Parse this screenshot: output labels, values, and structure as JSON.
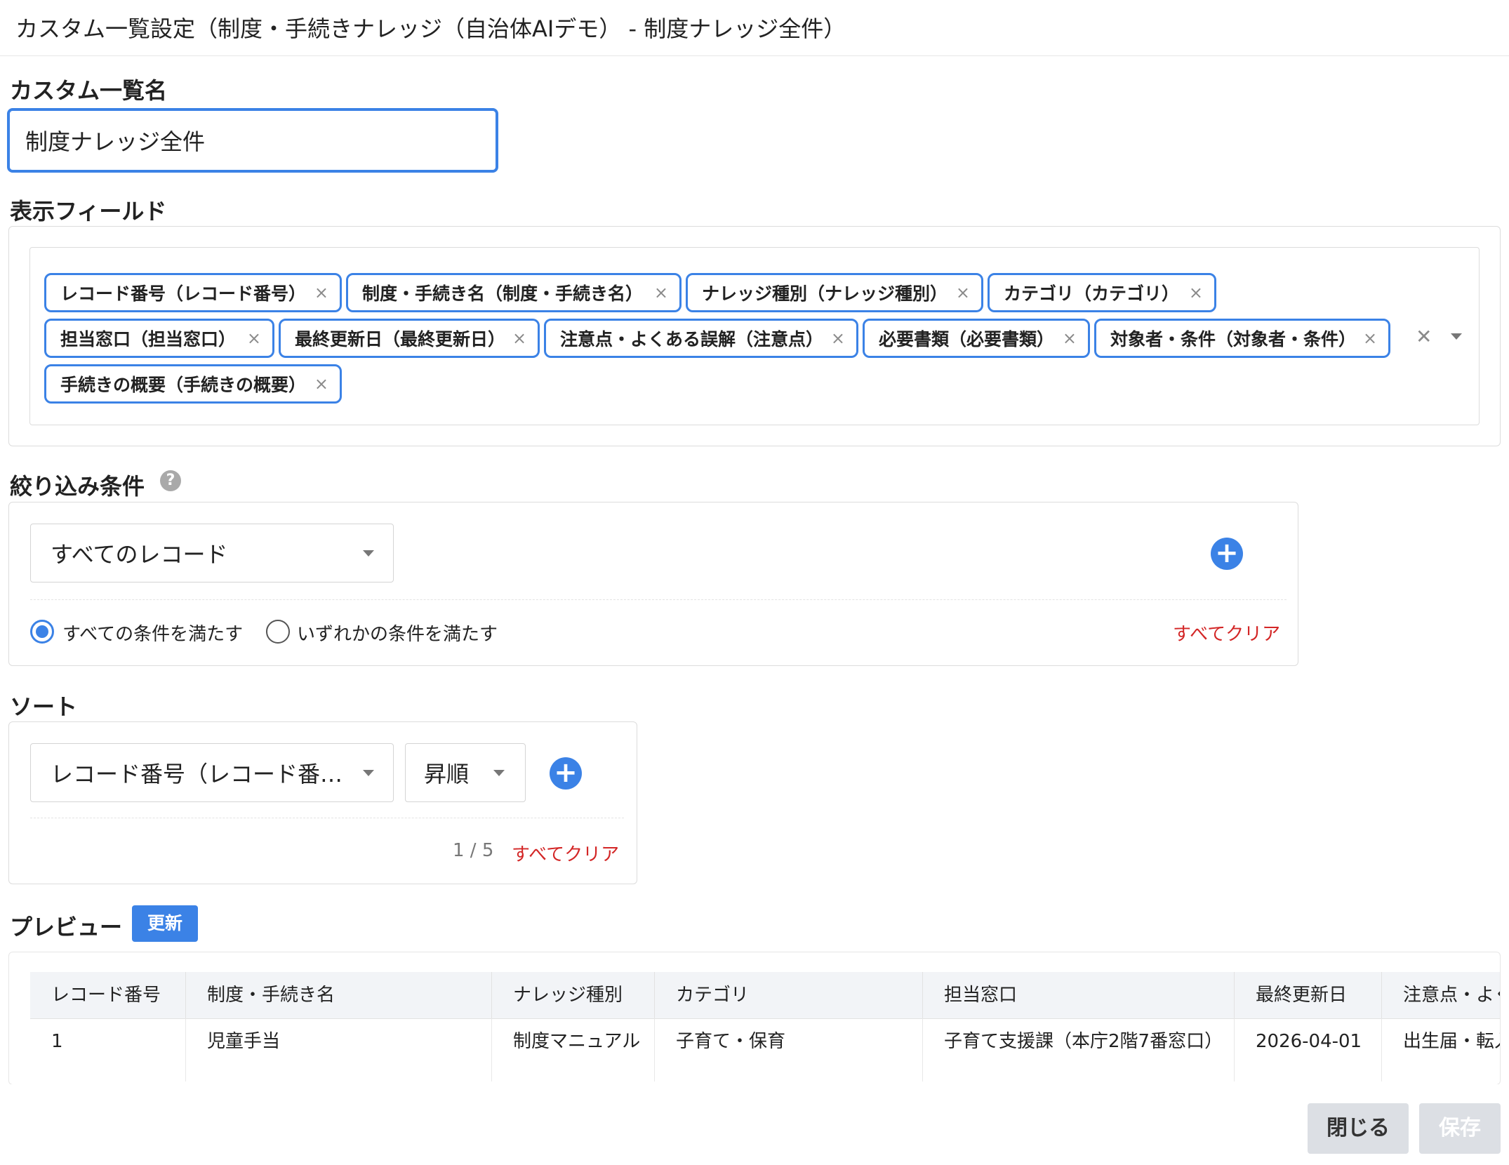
{
  "header": {
    "title": "カスタム一覧設定（制度・手続きナレッジ（自治体AIデモ） - 制度ナレッジ全件）"
  },
  "name_section": {
    "label": "カスタム一覧名",
    "value": "制度ナレッジ全件"
  },
  "fields_section": {
    "label": "表示フィールド",
    "tags": [
      "レコード番号（レコード番号）",
      "制度・手続き名（制度・手続き名）",
      "ナレッジ種別（ナレッジ種別）",
      "カテゴリ（カテゴリ）",
      "担当窓口（担当窓口）",
      "最終更新日（最終更新日）",
      "注意点・よくある誤解（注意点）",
      "必要書類（必要書類）",
      "対象者・条件（対象者・条件）",
      "手続きの概要（手続きの概要）"
    ],
    "remove_glyph": "×",
    "clear_glyph": "✕"
  },
  "filter_section": {
    "label": "絞り込み条件",
    "help_glyph": "?",
    "select_value": "すべてのレコード",
    "add_glyph": "+",
    "radio_all": "すべての条件を満たす",
    "radio_any": "いずれかの条件を満たす",
    "selected_radio": "all",
    "clear_all": "すべてクリア"
  },
  "sort_section": {
    "label": "ソート",
    "field_value": "レコード番号（レコード番…",
    "order_value": "昇順",
    "add_glyph": "+",
    "count": "1 / 5",
    "clear_all": "すべてクリア"
  },
  "preview_section": {
    "label": "プレビュー",
    "refresh_button": "更新",
    "columns": [
      "レコード番号",
      "制度・手続き名",
      "ナレッジ種別",
      "カテゴリ",
      "担当窓口",
      "最終更新日",
      "注意点・よく"
    ],
    "rows": [
      [
        "1",
        "児童手当",
        "制度マニュアル",
        "子育て・保育",
        "子育て支援課（本庁2階7番窓口）",
        "2026-04-01",
        "出生届・転入"
      ]
    ]
  },
  "footer": {
    "close_button": "閉じる",
    "save_button": "保存"
  },
  "colors": {
    "accent": "#3b82e6",
    "danger": "#d32626",
    "button_gray": "#dcdfe4"
  }
}
